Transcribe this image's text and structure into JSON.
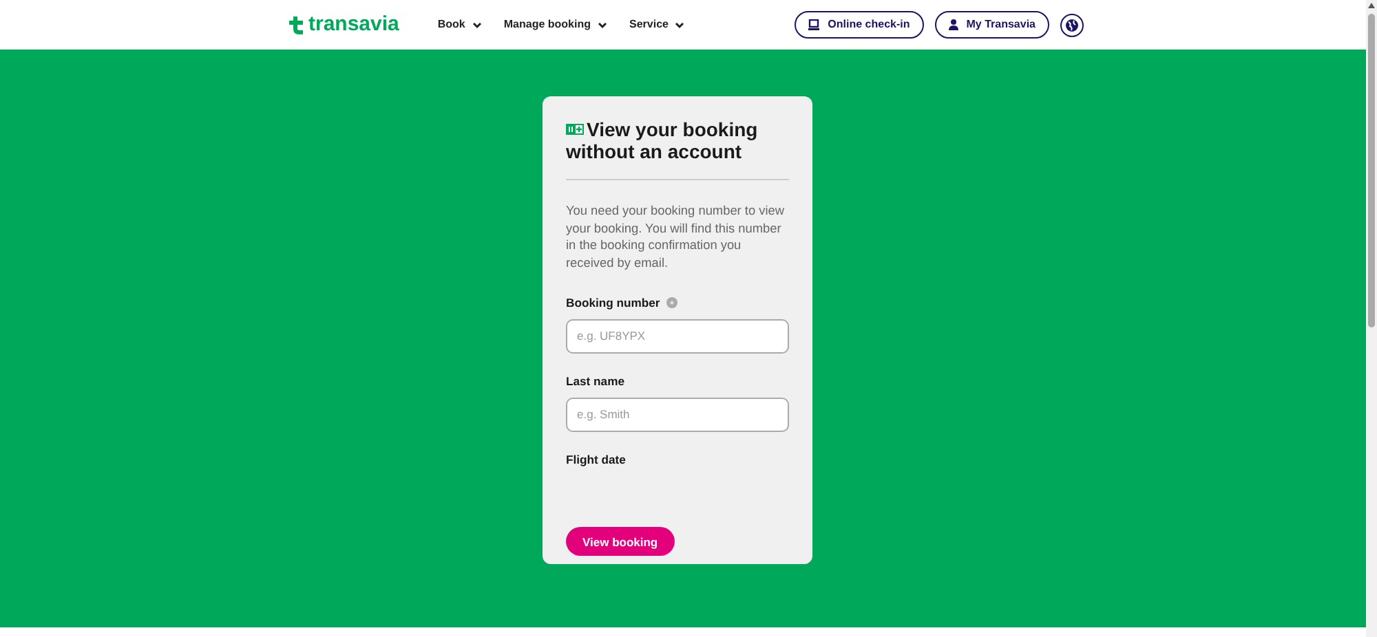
{
  "header": {
    "logo": "transavia",
    "nav": [
      {
        "label": "Book"
      },
      {
        "label": "Manage booking"
      },
      {
        "label": "Service"
      }
    ],
    "buttons": [
      {
        "label": "Online check-in",
        "kind": "checkin"
      },
      {
        "label": "My Transavia",
        "kind": "account"
      }
    ]
  },
  "card": {
    "title": "View your booking without an account",
    "intro": "You need your booking number to view your booking. You will find this number in the booking confirmation you received by email.",
    "fields": [
      {
        "label": "Booking number",
        "placeholder": "e.g. UF8YPX",
        "help": true
      },
      {
        "label": "Last name",
        "placeholder": "e.g. Smith",
        "help": false
      }
    ],
    "date_label": "Flight date",
    "submit": "View booking"
  }
}
